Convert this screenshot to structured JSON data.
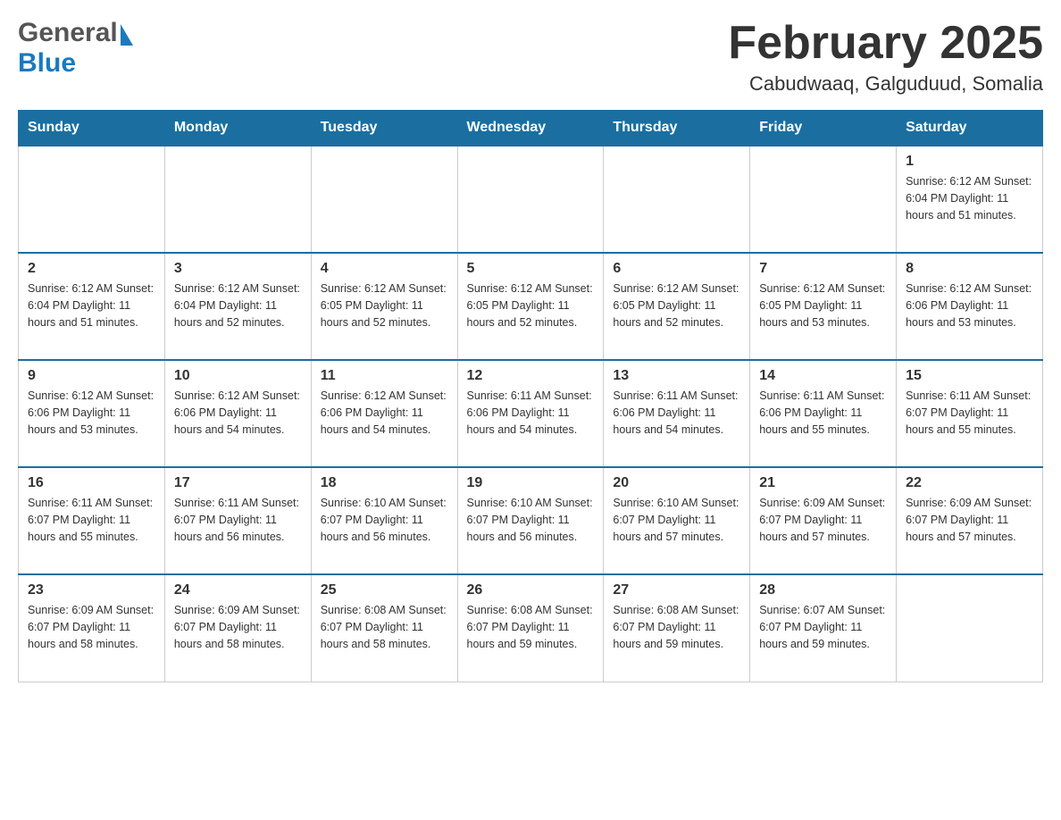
{
  "header": {
    "logo_general": "General",
    "logo_blue": "Blue",
    "month_title": "February 2025",
    "location": "Cabudwaaq, Galguduud, Somalia"
  },
  "weekdays": [
    "Sunday",
    "Monday",
    "Tuesday",
    "Wednesday",
    "Thursday",
    "Friday",
    "Saturday"
  ],
  "weeks": [
    [
      {
        "day": "",
        "info": ""
      },
      {
        "day": "",
        "info": ""
      },
      {
        "day": "",
        "info": ""
      },
      {
        "day": "",
        "info": ""
      },
      {
        "day": "",
        "info": ""
      },
      {
        "day": "",
        "info": ""
      },
      {
        "day": "1",
        "info": "Sunrise: 6:12 AM\nSunset: 6:04 PM\nDaylight: 11 hours\nand 51 minutes."
      }
    ],
    [
      {
        "day": "2",
        "info": "Sunrise: 6:12 AM\nSunset: 6:04 PM\nDaylight: 11 hours\nand 51 minutes."
      },
      {
        "day": "3",
        "info": "Sunrise: 6:12 AM\nSunset: 6:04 PM\nDaylight: 11 hours\nand 52 minutes."
      },
      {
        "day": "4",
        "info": "Sunrise: 6:12 AM\nSunset: 6:05 PM\nDaylight: 11 hours\nand 52 minutes."
      },
      {
        "day": "5",
        "info": "Sunrise: 6:12 AM\nSunset: 6:05 PM\nDaylight: 11 hours\nand 52 minutes."
      },
      {
        "day": "6",
        "info": "Sunrise: 6:12 AM\nSunset: 6:05 PM\nDaylight: 11 hours\nand 52 minutes."
      },
      {
        "day": "7",
        "info": "Sunrise: 6:12 AM\nSunset: 6:05 PM\nDaylight: 11 hours\nand 53 minutes."
      },
      {
        "day": "8",
        "info": "Sunrise: 6:12 AM\nSunset: 6:06 PM\nDaylight: 11 hours\nand 53 minutes."
      }
    ],
    [
      {
        "day": "9",
        "info": "Sunrise: 6:12 AM\nSunset: 6:06 PM\nDaylight: 11 hours\nand 53 minutes."
      },
      {
        "day": "10",
        "info": "Sunrise: 6:12 AM\nSunset: 6:06 PM\nDaylight: 11 hours\nand 54 minutes."
      },
      {
        "day": "11",
        "info": "Sunrise: 6:12 AM\nSunset: 6:06 PM\nDaylight: 11 hours\nand 54 minutes."
      },
      {
        "day": "12",
        "info": "Sunrise: 6:11 AM\nSunset: 6:06 PM\nDaylight: 11 hours\nand 54 minutes."
      },
      {
        "day": "13",
        "info": "Sunrise: 6:11 AM\nSunset: 6:06 PM\nDaylight: 11 hours\nand 54 minutes."
      },
      {
        "day": "14",
        "info": "Sunrise: 6:11 AM\nSunset: 6:06 PM\nDaylight: 11 hours\nand 55 minutes."
      },
      {
        "day": "15",
        "info": "Sunrise: 6:11 AM\nSunset: 6:07 PM\nDaylight: 11 hours\nand 55 minutes."
      }
    ],
    [
      {
        "day": "16",
        "info": "Sunrise: 6:11 AM\nSunset: 6:07 PM\nDaylight: 11 hours\nand 55 minutes."
      },
      {
        "day": "17",
        "info": "Sunrise: 6:11 AM\nSunset: 6:07 PM\nDaylight: 11 hours\nand 56 minutes."
      },
      {
        "day": "18",
        "info": "Sunrise: 6:10 AM\nSunset: 6:07 PM\nDaylight: 11 hours\nand 56 minutes."
      },
      {
        "day": "19",
        "info": "Sunrise: 6:10 AM\nSunset: 6:07 PM\nDaylight: 11 hours\nand 56 minutes."
      },
      {
        "day": "20",
        "info": "Sunrise: 6:10 AM\nSunset: 6:07 PM\nDaylight: 11 hours\nand 57 minutes."
      },
      {
        "day": "21",
        "info": "Sunrise: 6:09 AM\nSunset: 6:07 PM\nDaylight: 11 hours\nand 57 minutes."
      },
      {
        "day": "22",
        "info": "Sunrise: 6:09 AM\nSunset: 6:07 PM\nDaylight: 11 hours\nand 57 minutes."
      }
    ],
    [
      {
        "day": "23",
        "info": "Sunrise: 6:09 AM\nSunset: 6:07 PM\nDaylight: 11 hours\nand 58 minutes."
      },
      {
        "day": "24",
        "info": "Sunrise: 6:09 AM\nSunset: 6:07 PM\nDaylight: 11 hours\nand 58 minutes."
      },
      {
        "day": "25",
        "info": "Sunrise: 6:08 AM\nSunset: 6:07 PM\nDaylight: 11 hours\nand 58 minutes."
      },
      {
        "day": "26",
        "info": "Sunrise: 6:08 AM\nSunset: 6:07 PM\nDaylight: 11 hours\nand 59 minutes."
      },
      {
        "day": "27",
        "info": "Sunrise: 6:08 AM\nSunset: 6:07 PM\nDaylight: 11 hours\nand 59 minutes."
      },
      {
        "day": "28",
        "info": "Sunrise: 6:07 AM\nSunset: 6:07 PM\nDaylight: 11 hours\nand 59 minutes."
      },
      {
        "day": "",
        "info": ""
      }
    ]
  ],
  "colors": {
    "header_bg": "#1a6fa0",
    "header_text": "#ffffff",
    "border": "#cccccc",
    "text": "#333333"
  }
}
